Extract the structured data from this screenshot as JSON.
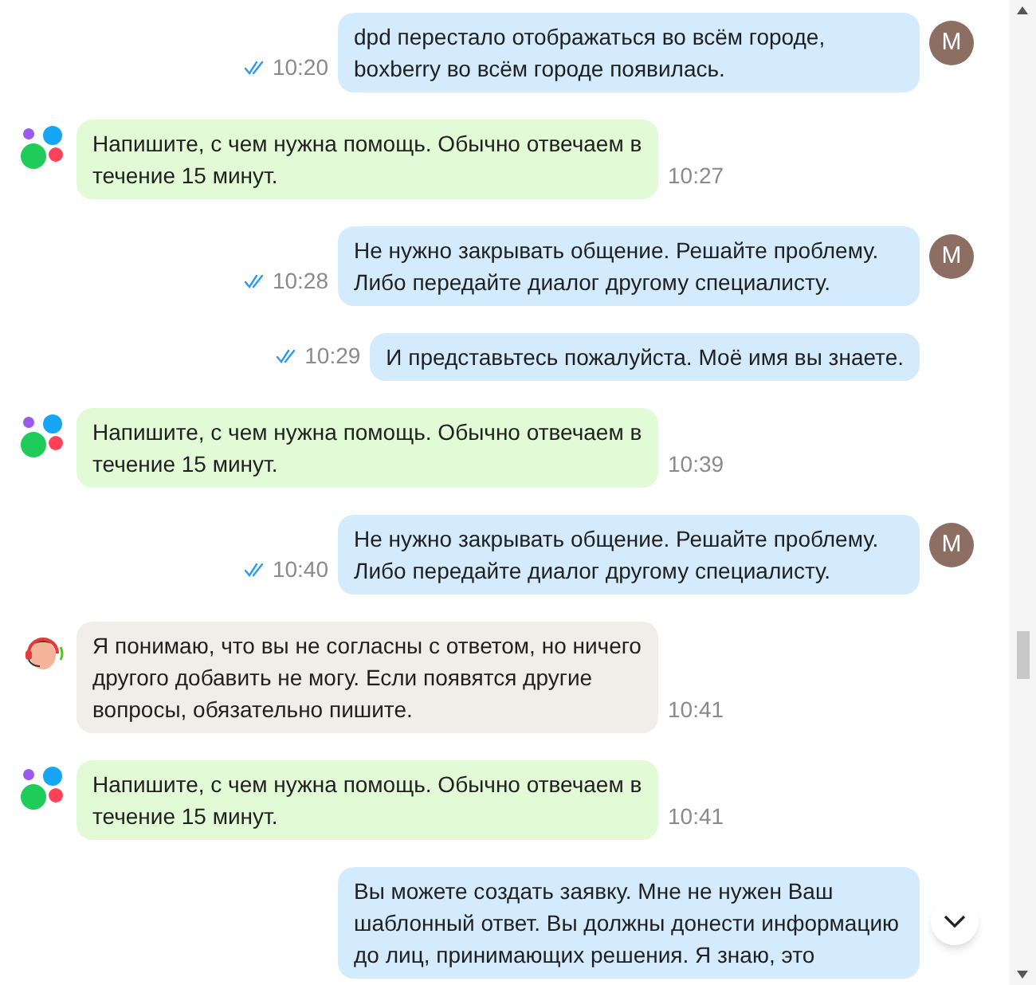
{
  "messages": [
    {
      "kind": "outgoing",
      "text": "dpd перестало отображаться во всём городе, boxberry во всём городе появилась.",
      "time": "10:20",
      "read": true,
      "avatar": "M"
    },
    {
      "kind": "bot",
      "text": "Напишите, с чем нужна помощь. Обычно отвечаем в течение 15 минут.",
      "time": "10:27"
    },
    {
      "kind": "outgoing",
      "text": "Не нужно закрывать общение. Решайте проблему. Либо передайте диалог другому специалисту.",
      "time": "10:28",
      "read": true,
      "avatar": "M"
    },
    {
      "kind": "outgoing",
      "text": "И представьтесь пожалуйста. Моё имя вы знаете.",
      "time": "10:29",
      "read": true
    },
    {
      "kind": "bot",
      "text": "Напишите, с чем нужна помощь. Обычно отвечаем в течение 15 минут.",
      "time": "10:39"
    },
    {
      "kind": "outgoing",
      "text": "Не нужно закрывать общение. Решайте проблему. Либо передайте диалог другому специалисту.",
      "time": "10:40",
      "read": true,
      "avatar": "M"
    },
    {
      "kind": "agent",
      "text": "Я понимаю, что вы не согласны с ответом, но ничего другого добавить не могу. Если появятся другие вопросы, обязательно пишите.",
      "time": "10:41"
    },
    {
      "kind": "bot",
      "text": "Напишите, с чем нужна помощь. Обычно отвечаем в течение 15 минут.",
      "time": "10:41"
    },
    {
      "kind": "outgoing",
      "text": "Вы можете создать заявку. Мне не нужен Ваш шаблонный ответ. Вы должны донести информацию до лиц, принимающих решения. Я знаю, это"
    }
  ]
}
